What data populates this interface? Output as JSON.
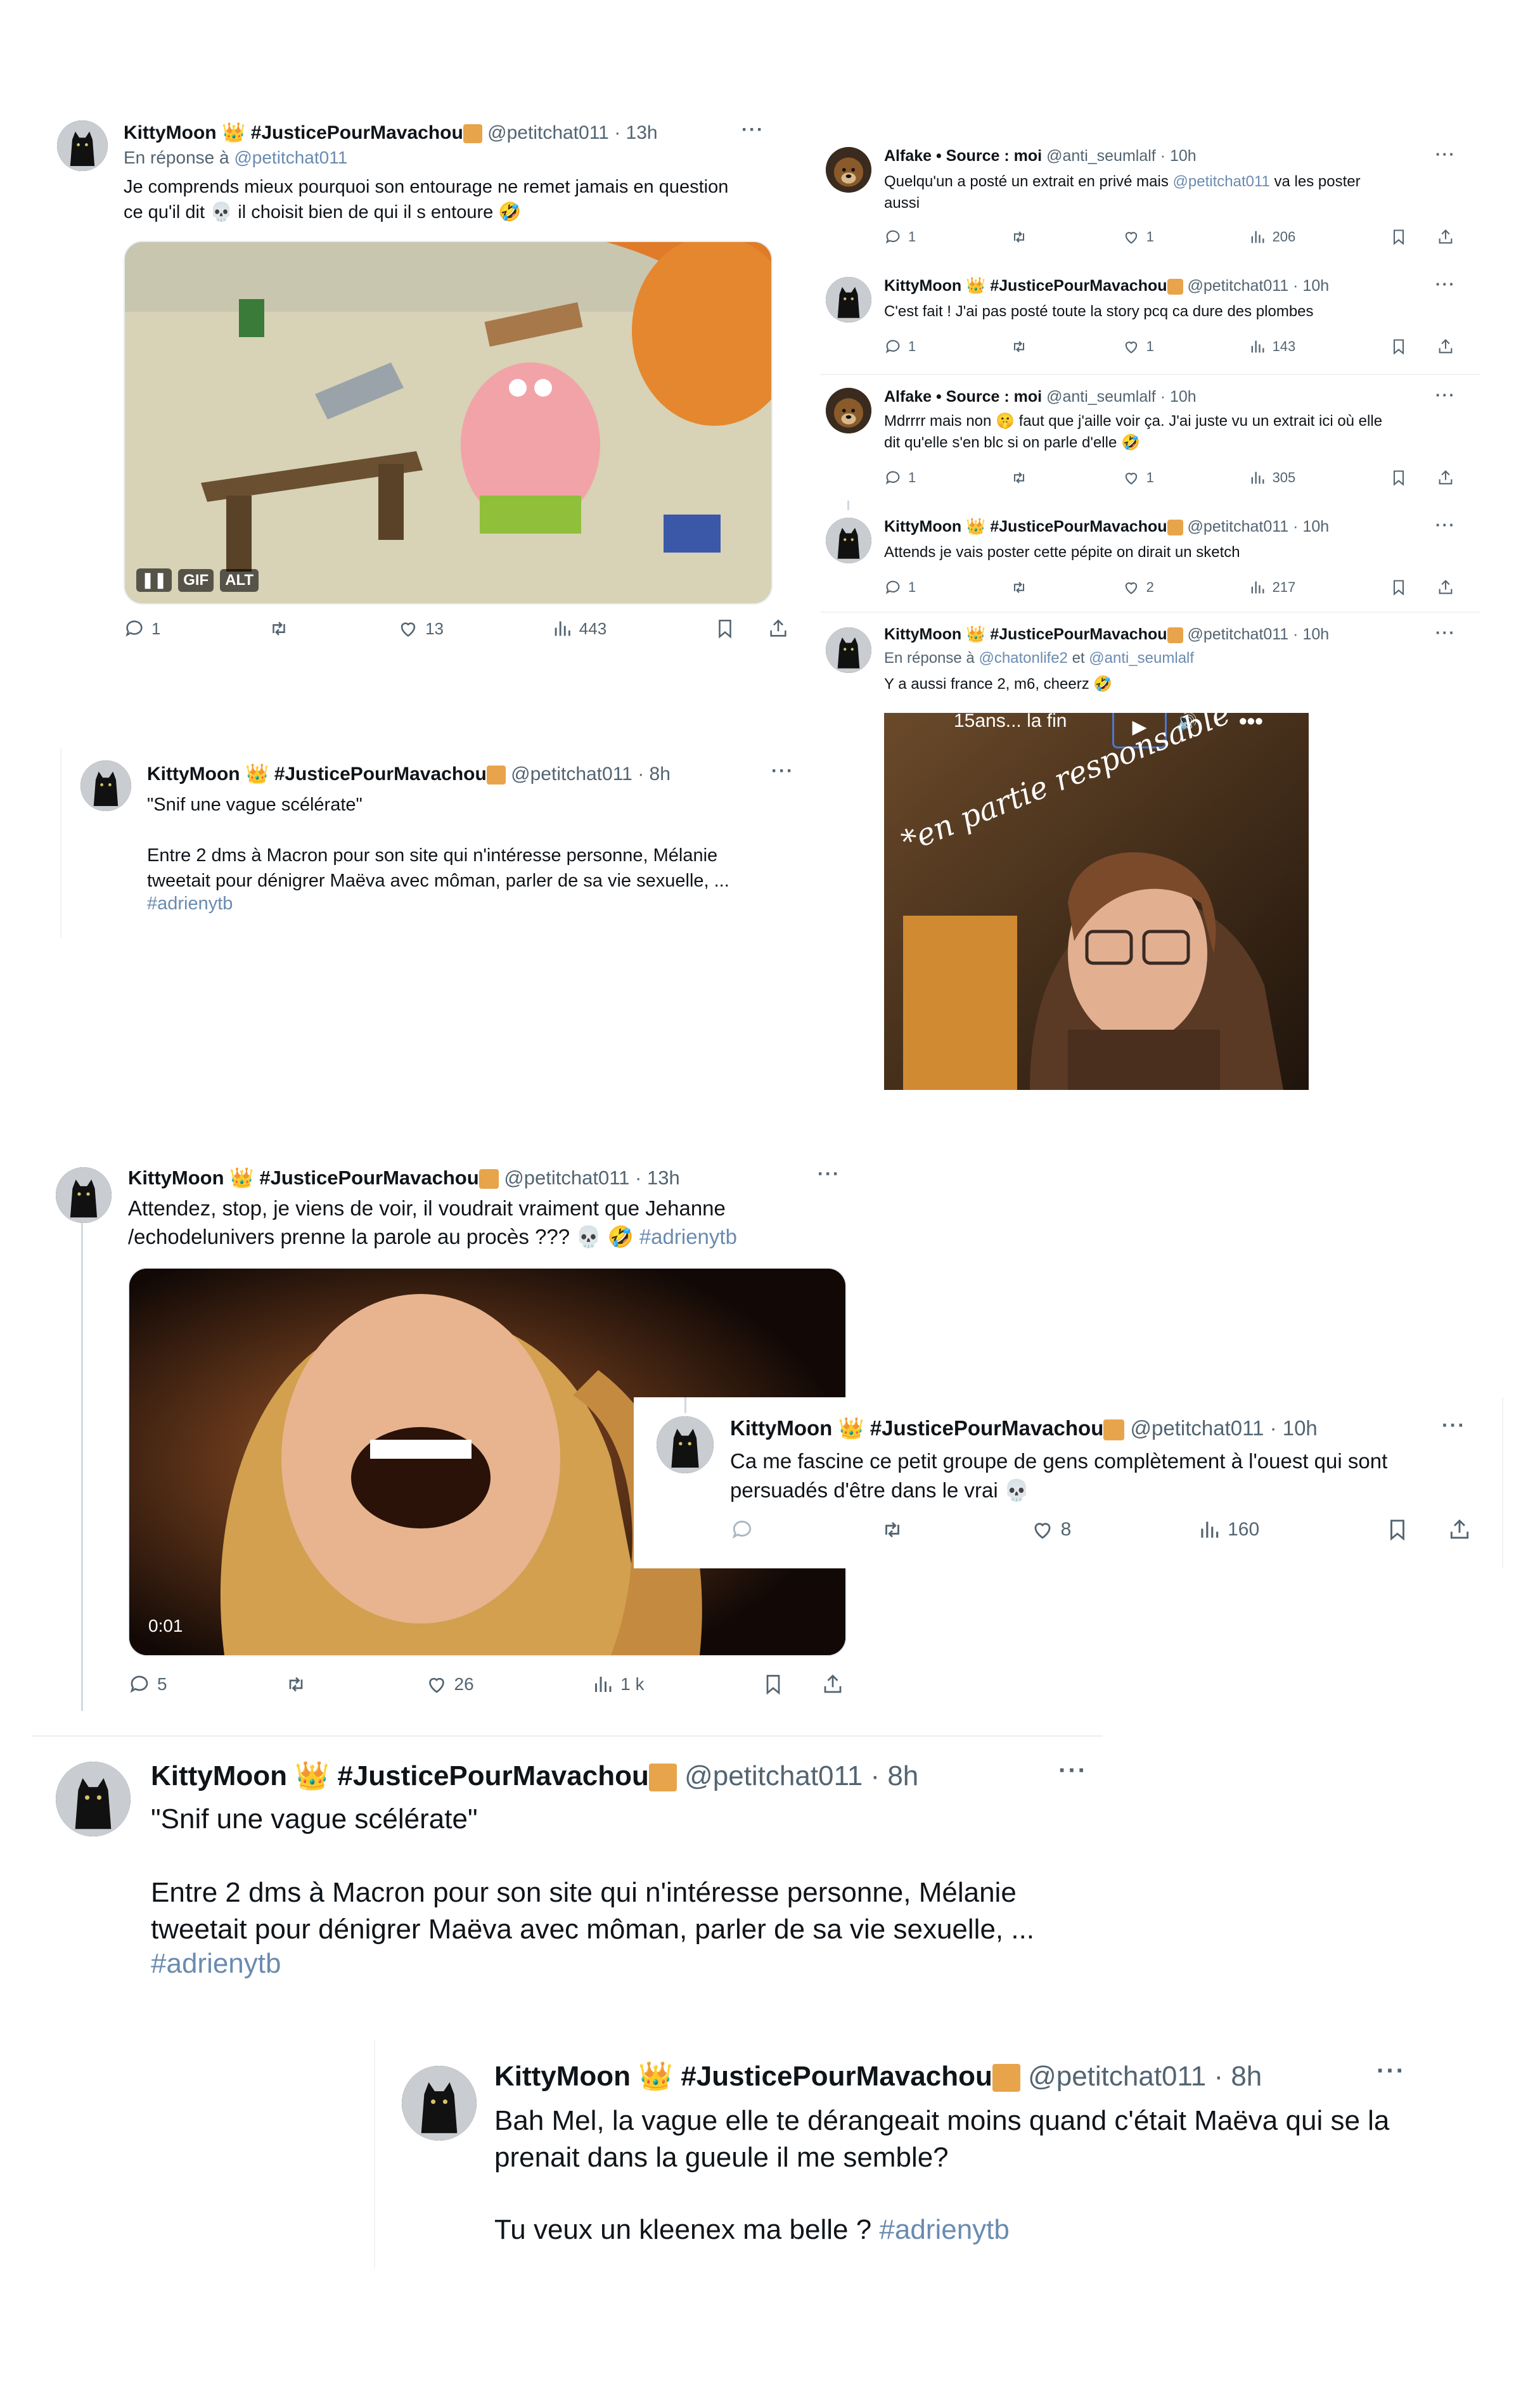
{
  "common": {
    "name": "KittyMoon",
    "crown": "👑",
    "hashtag_name": "#JusticePourMavachou",
    "handle": "@petitchat011",
    "more": "···",
    "reply_prefix": "En réponse à"
  },
  "alfake": {
    "name": "Alfake • Source : moi",
    "handle": "@anti_seumlalf"
  },
  "t1": {
    "time": "· 13h",
    "reply_to": "@petitchat011",
    "text": "Je comprends mieux pourquoi son entourage ne remet jamais en question\nce qu'il dit 💀 il choisit bien de qui il s entoure 🤣",
    "gif_label": "GIF",
    "alt_label": "ALT",
    "replies": "1",
    "likes": "13",
    "views": "443"
  },
  "t2": {
    "time": "· 8h",
    "line1": "\"Snif une vague scélérate\"",
    "line2": "Entre 2 dms à Macron pour son site qui n'intéresse personne, Mélanie\ntweetait pour dénigrer Maëva avec môman, parler de sa vie sexuelle, ...",
    "hashtag": "#adrienytb"
  },
  "r1": {
    "time": "· 10h",
    "text_a": "Quelqu'un a posté un extrait en privé mais ",
    "text_link": "@petitchat011",
    "text_b": " va les poster\naussi",
    "replies": "1",
    "likes": "1",
    "views": "206"
  },
  "r2": {
    "time": "· 10h",
    "text": "C'est fait ! J'ai pas posté toute la story pcq ca dure des plombes",
    "replies": "1",
    "likes": "1",
    "views": "143"
  },
  "r3": {
    "time": "· 10h",
    "text": "Mdrrrr mais non 🤫 faut que j'aille voir ça. J'ai juste vu un extrait ici où elle\ndit qu'elle s'en blc si on parle d'elle 🤣",
    "replies": "1",
    "likes": "1",
    "views": "305"
  },
  "r4": {
    "time": "· 10h",
    "text": "Attends je vais poster cette pépite on dirait un sketch",
    "replies": "1",
    "likes": "2",
    "views": "217"
  },
  "r5": {
    "time": "· 10h",
    "reply_to_a": "@chatonlife2",
    "reply_et": "et",
    "reply_to_b": "@anti_seumlalf",
    "text": "Y a aussi france 2, m6, cheerz 🤣",
    "video_title": "15ans... la fin",
    "overlay_text": "*en partie responsable"
  },
  "t3": {
    "time": "· 13h",
    "text": "Attendez, stop, je viens de voir, il voudrait vraiment que Jehanne\n/echodelunivers prenne la parole au procès ??? 💀 🤣 ",
    "hashtag": "#adrienytb",
    "duration": "0:01",
    "replies": "5",
    "likes": "26",
    "views": "1 k"
  },
  "t4": {
    "time": "· 10h",
    "text": "Ca me fascine ce petit groupe de gens complètement à l'ouest qui sont\npersuadés d'être dans le vrai 💀",
    "likes": "8",
    "views": "160"
  },
  "t5": {
    "time": "· 8h",
    "line1": "\"Snif une vague scélérate\"",
    "line2": "Entre 2 dms à Macron pour son site qui n'intéresse personne, Mélanie\ntweetait pour dénigrer Maëva avec môman, parler de sa vie sexuelle, ...",
    "hashtag": "#adrienytb"
  },
  "t6": {
    "time": "· 8h",
    "line1": "Bah Mel, la vague elle te dérangeait moins quand c'était Maëva qui se la\nprenait dans la gueule il me semble?",
    "line2": "Tu veux un kleenex ma belle ? ",
    "hashtag": "#adrienytb"
  },
  "colors": {
    "link": "#6a8bb0",
    "muted": "#536471",
    "text": "#0f1419"
  }
}
